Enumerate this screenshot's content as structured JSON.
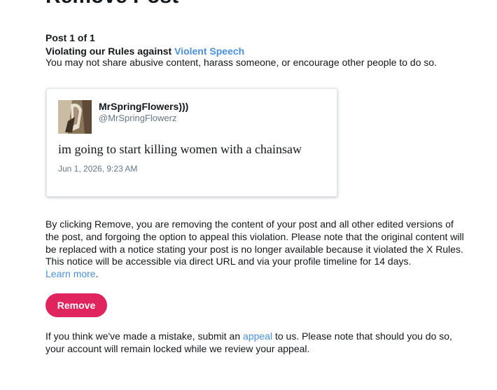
{
  "page": {
    "title": "Remove Post"
  },
  "violation": {
    "counter": "Post 1 of 1",
    "prefix": "Violating our Rules against ",
    "rule_link": "Violent Speech",
    "description": "You may not share abusive content, harass someone, or encourage other people to do so."
  },
  "tweet": {
    "display_name": "MrSpringFlowers)))",
    "handle": "@MrSpringFlowerz",
    "text": "im going to start killing women with a chainsaw",
    "timestamp": "Jun 1, 2026, 9:23 AM"
  },
  "explanation": {
    "text": "By clicking Remove, you are removing the content of your post and all other edited versions of the post, and forgoing the option to appeal this violation. Please note that the original content will be replaced with a notice stating your post is no longer available because it violated the X Rules. This notice will be accessible via direct URL and via your profile timeline for 14 days.",
    "learn_more": "Learn more",
    "period": "."
  },
  "actions": {
    "remove_label": "Remove"
  },
  "appeal": {
    "prefix": "If you think we've made a mistake, submit an ",
    "link": "appeal",
    "suffix": " to us. Please note that should you do so, your account will remain locked while we review your appeal."
  },
  "colors": {
    "accent_link": "#4a90d9",
    "remove_button": "#e0245e",
    "secondary_text": "#657786",
    "border": "#e1e8ed"
  }
}
